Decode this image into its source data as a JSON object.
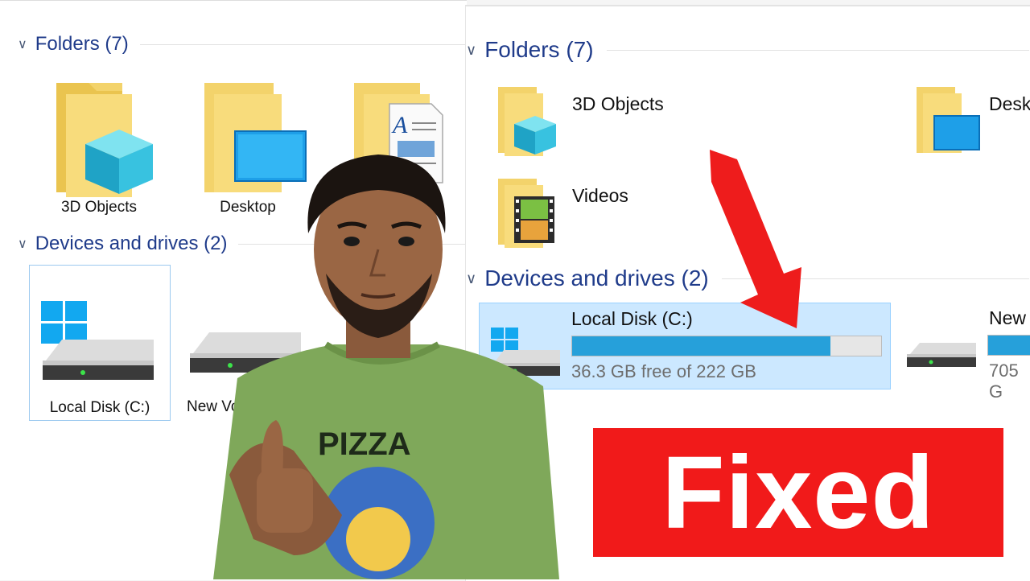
{
  "left_panel": {
    "folders_header": "Folders (7)",
    "devices_header": "Devices and drives (2)",
    "folders": [
      {
        "label": "3D Objects",
        "icon": "folder-3d-objects-icon"
      },
      {
        "label": "Desktop",
        "icon": "folder-desktop-icon"
      },
      {
        "label": "",
        "icon": "folder-documents-icon"
      }
    ],
    "drives": [
      {
        "label": "Local Disk (C:)",
        "icon": "windows-drive-icon",
        "selected": true
      },
      {
        "label": "New Vol",
        "icon": "drive-icon"
      }
    ]
  },
  "right_panel": {
    "folders_header": "Folders (7)",
    "devices_header": "Devices and drives (2)",
    "folders": [
      {
        "label": "3D Objects",
        "icon": "folder-3d-objects-icon"
      },
      {
        "label": "Desk",
        "icon": "folder-desktop-icon"
      },
      {
        "label": "Videos",
        "icon": "folder-videos-icon"
      }
    ],
    "drives": [
      {
        "label": "Local Disk (C:)",
        "free_text": "36.3 GB free of 222 GB",
        "usage_fraction": 0.836,
        "icon": "windows-drive-icon",
        "selected": true
      },
      {
        "label": "New",
        "free_text": "705 G",
        "usage_fraction": 0.9,
        "icon": "drive-icon"
      }
    ]
  },
  "overlay": {
    "badge_text": "Fixed",
    "shirt_text": "PIZZA",
    "colors": {
      "badge": "#f11a1a",
      "arrow": "#ee1c1c",
      "usage_bar": "#26a0da",
      "selection": "#cce8ff",
      "shirt": "#7fa85a"
    }
  }
}
